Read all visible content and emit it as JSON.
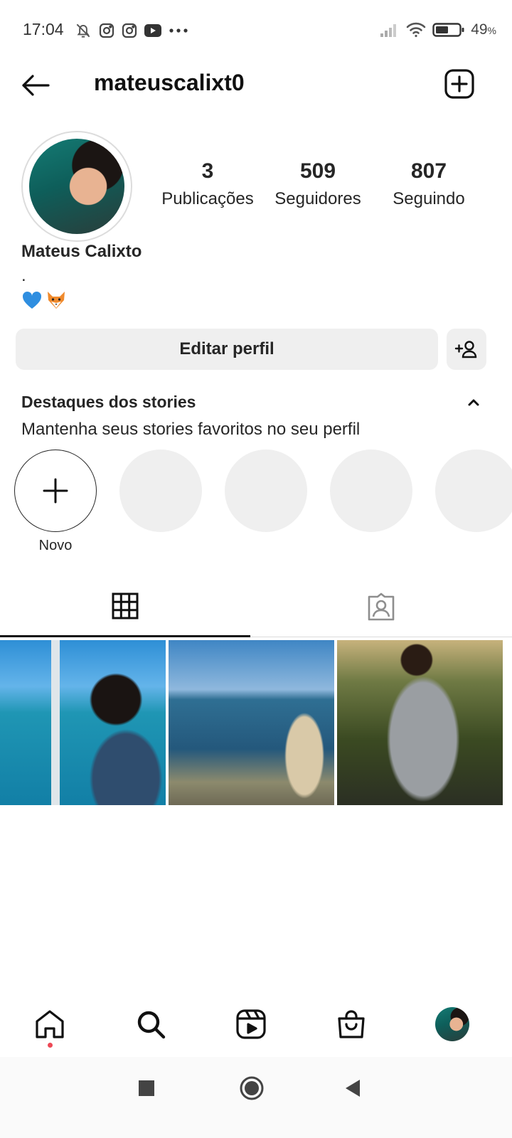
{
  "status_bar": {
    "time": "17:04",
    "battery_percent": "49",
    "battery_unit": "%",
    "icons_left": [
      "bell-muted-icon",
      "instagram-icon",
      "instagram-icon",
      "youtube-icon",
      "more-dots-icon"
    ],
    "icons_right": [
      "signal-icon",
      "wifi-icon",
      "battery-icon"
    ]
  },
  "header": {
    "username": "mateuscalixt0"
  },
  "profile": {
    "full_name": "Mateus Calixto",
    "bio_line": ".",
    "bio_emojis": [
      "blue-heart-icon",
      "fox-icon"
    ],
    "stats": [
      {
        "value": "3",
        "label": "Publicações"
      },
      {
        "value": "509",
        "label": "Seguidores"
      },
      {
        "value": "807",
        "label": "Seguindo"
      }
    ]
  },
  "actions": {
    "edit_profile": "Editar perfil"
  },
  "highlights": {
    "title": "Destaques dos stories",
    "subtitle": "Mantenha seus stories favoritos no seu perfil",
    "new_label": "Novo"
  },
  "tabs": [
    "grid-icon",
    "tagged-icon"
  ],
  "posts": [
    {
      "description": "photo-boat-sea"
    },
    {
      "description": "photo-rocky-shore"
    },
    {
      "description": "photo-sunset-portrait"
    }
  ],
  "bottom_nav": [
    "home-icon",
    "search-icon",
    "reels-icon",
    "shop-icon",
    "profile-avatar"
  ],
  "colors": {
    "notification_dot": "#ed4956",
    "button_bg": "#efefef",
    "text": "#262626"
  }
}
